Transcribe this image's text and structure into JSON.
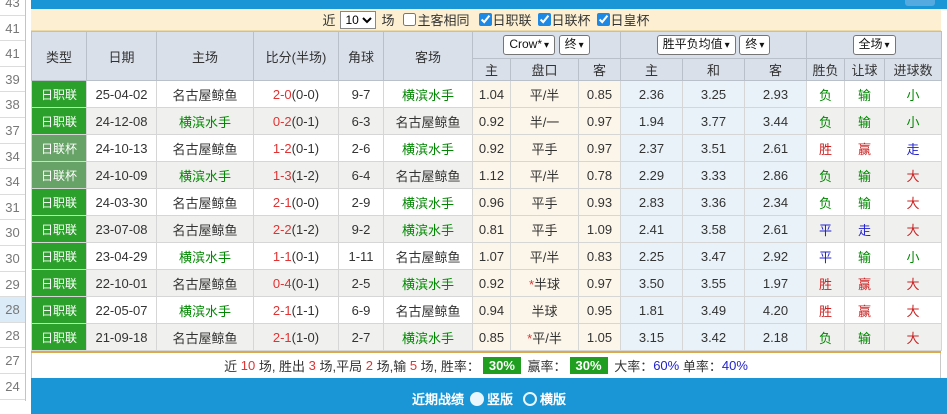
{
  "colors": {
    "bar_blue": "#1a96d6",
    "chip_blue": "#55abe0",
    "cream": "#fdf0d2",
    "header_bg": "#d9e0ea",
    "league_green": "#2ba12b",
    "cup_green": "#67a267",
    "team_green": "#008800",
    "score_red": "#e03333",
    "win_red": "#cc2222",
    "draw_blue": "#2222cc",
    "rate_badge_green": "#1f9e1f",
    "handicap_col_bg": "#fcf6ea",
    "avg_col_bg": "#e9f2f8",
    "row_alt_bg": "#f0f0ee"
  },
  "left_gutter": {
    "numbers": [
      "43",
      "41",
      "41",
      "39",
      "38",
      "37",
      "34",
      "34",
      "31",
      "30",
      "30",
      "29",
      "28",
      "28",
      "27",
      "24"
    ],
    "highlighted_index": 12
  },
  "filter_bar": {
    "recent_prefix": "近",
    "recent_value": "10",
    "recent_suffix": "场",
    "same_venue_label": "主客相同",
    "same_venue_checked": false,
    "leagues": [
      {
        "label": "日职联",
        "checked": true
      },
      {
        "label": "日联杯",
        "checked": true
      },
      {
        "label": "日皇杯",
        "checked": true
      }
    ]
  },
  "table": {
    "columns": [
      "类型",
      "日期",
      "主场",
      "比分(半场)",
      "角球",
      "客场"
    ],
    "group_selects": {
      "odds_source": "Crow*",
      "odds_time": "终",
      "avg_label": "胜平负均值",
      "avg_time": "终",
      "scope": "全场"
    },
    "sub_headers": [
      "主",
      "盘口",
      "客",
      "主",
      "和",
      "客",
      "胜负",
      "让球",
      "进球数"
    ],
    "rows": [
      {
        "league": "日职联",
        "cup": false,
        "date": "25-04-02",
        "home": "名古屋鲸鱼",
        "home_focus": false,
        "score": "2-0",
        "half": "(0-0)",
        "corners": "9-7",
        "away": "横滨水手",
        "away_focus": true,
        "odds": [
          "1.04",
          "平/半",
          "0.85"
        ],
        "star": false,
        "avg": [
          "2.36",
          "3.25",
          "2.93"
        ],
        "results": [
          {
            "t": "负",
            "c": "g"
          },
          {
            "t": "输",
            "c": "g"
          },
          {
            "t": "小",
            "c": "g"
          }
        ]
      },
      {
        "league": "日职联",
        "cup": false,
        "date": "24-12-08",
        "home": "横滨水手",
        "home_focus": true,
        "score": "0-2",
        "half": "(0-1)",
        "corners": "6-3",
        "away": "名古屋鲸鱼",
        "away_focus": false,
        "odds": [
          "0.92",
          "半/一",
          "0.97"
        ],
        "star": false,
        "avg": [
          "1.94",
          "3.77",
          "3.44"
        ],
        "results": [
          {
            "t": "负",
            "c": "g"
          },
          {
            "t": "输",
            "c": "g"
          },
          {
            "t": "小",
            "c": "g"
          }
        ]
      },
      {
        "league": "日联杯",
        "cup": true,
        "date": "24-10-13",
        "home": "名古屋鲸鱼",
        "home_focus": false,
        "score": "1-2",
        "half": "(0-1)",
        "corners": "2-6",
        "away": "横滨水手",
        "away_focus": true,
        "odds": [
          "0.92",
          "平手",
          "0.97"
        ],
        "star": false,
        "avg": [
          "2.37",
          "3.51",
          "2.61"
        ],
        "results": [
          {
            "t": "胜",
            "c": "r"
          },
          {
            "t": "赢",
            "c": "r"
          },
          {
            "t": "走",
            "c": "b"
          }
        ]
      },
      {
        "league": "日联杯",
        "cup": true,
        "date": "24-10-09",
        "home": "横滨水手",
        "home_focus": true,
        "score": "1-3",
        "half": "(1-2)",
        "corners": "6-4",
        "away": "名古屋鲸鱼",
        "away_focus": false,
        "odds": [
          "1.12",
          "平/半",
          "0.78"
        ],
        "star": false,
        "avg": [
          "2.29",
          "3.33",
          "2.86"
        ],
        "results": [
          {
            "t": "负",
            "c": "g"
          },
          {
            "t": "输",
            "c": "g"
          },
          {
            "t": "大",
            "c": "r"
          }
        ]
      },
      {
        "league": "日职联",
        "cup": false,
        "date": "24-03-30",
        "home": "名古屋鲸鱼",
        "home_focus": false,
        "score": "2-1",
        "half": "(0-0)",
        "corners": "2-9",
        "away": "横滨水手",
        "away_focus": true,
        "odds": [
          "0.96",
          "平手",
          "0.93"
        ],
        "star": false,
        "avg": [
          "2.83",
          "3.36",
          "2.34"
        ],
        "results": [
          {
            "t": "负",
            "c": "g"
          },
          {
            "t": "输",
            "c": "g"
          },
          {
            "t": "大",
            "c": "r"
          }
        ]
      },
      {
        "league": "日职联",
        "cup": false,
        "date": "23-07-08",
        "home": "名古屋鲸鱼",
        "home_focus": false,
        "score": "2-2",
        "half": "(1-2)",
        "corners": "9-2",
        "away": "横滨水手",
        "away_focus": true,
        "odds": [
          "0.81",
          "平手",
          "1.09"
        ],
        "star": false,
        "avg": [
          "2.41",
          "3.58",
          "2.61"
        ],
        "results": [
          {
            "t": "平",
            "c": "b"
          },
          {
            "t": "走",
            "c": "b"
          },
          {
            "t": "大",
            "c": "r"
          }
        ]
      },
      {
        "league": "日职联",
        "cup": false,
        "date": "23-04-29",
        "home": "横滨水手",
        "home_focus": true,
        "score": "1-1",
        "half": "(0-1)",
        "corners": "1-11",
        "away": "名古屋鲸鱼",
        "away_focus": false,
        "odds": [
          "1.07",
          "平/半",
          "0.83"
        ],
        "star": false,
        "avg": [
          "2.25",
          "3.47",
          "2.92"
        ],
        "results": [
          {
            "t": "平",
            "c": "b"
          },
          {
            "t": "输",
            "c": "g"
          },
          {
            "t": "小",
            "c": "g"
          }
        ]
      },
      {
        "league": "日职联",
        "cup": false,
        "date": "22-10-01",
        "home": "名古屋鲸鱼",
        "home_focus": false,
        "score": "0-4",
        "half": "(0-1)",
        "corners": "2-5",
        "away": "横滨水手",
        "away_focus": true,
        "odds": [
          "0.92",
          "半球",
          "0.97"
        ],
        "star": true,
        "avg": [
          "3.50",
          "3.55",
          "1.97"
        ],
        "results": [
          {
            "t": "胜",
            "c": "r"
          },
          {
            "t": "赢",
            "c": "r"
          },
          {
            "t": "大",
            "c": "r"
          }
        ]
      },
      {
        "league": "日职联",
        "cup": false,
        "date": "22-05-07",
        "home": "横滨水手",
        "home_focus": true,
        "score": "2-1",
        "half": "(1-1)",
        "corners": "6-9",
        "away": "名古屋鲸鱼",
        "away_focus": false,
        "odds": [
          "0.94",
          "半球",
          "0.95"
        ],
        "star": false,
        "avg": [
          "1.81",
          "3.49",
          "4.20"
        ],
        "results": [
          {
            "t": "胜",
            "c": "r"
          },
          {
            "t": "赢",
            "c": "r"
          },
          {
            "t": "大",
            "c": "r"
          }
        ]
      },
      {
        "league": "日职联",
        "cup": false,
        "date": "21-09-18",
        "home": "名古屋鲸鱼",
        "home_focus": false,
        "score": "2-1",
        "half": "(1-0)",
        "corners": "2-7",
        "away": "横滨水手",
        "away_focus": true,
        "odds": [
          "0.85",
          "平/半",
          "1.05"
        ],
        "star": true,
        "avg": [
          "3.15",
          "3.42",
          "2.18"
        ],
        "results": [
          {
            "t": "负",
            "c": "g"
          },
          {
            "t": "输",
            "c": "g"
          },
          {
            "t": "大",
            "c": "r"
          }
        ]
      }
    ]
  },
  "summary": {
    "segments": [
      {
        "t": "近 ",
        "c": "n"
      },
      {
        "t": "10",
        "c": "r"
      },
      {
        "t": " 场, 胜出 ",
        "c": "n"
      },
      {
        "t": "3",
        "c": "r"
      },
      {
        "t": " 场,平局 ",
        "c": "n"
      },
      {
        "t": "2",
        "c": "r"
      },
      {
        "t": " 场,输 ",
        "c": "n"
      },
      {
        "t": "5",
        "c": "r"
      },
      {
        "t": " 场, 胜率：",
        "c": "n"
      },
      {
        "t": "30%",
        "c": "badge"
      },
      {
        "t": " 赢率：",
        "c": "n"
      },
      {
        "t": "30%",
        "c": "badge"
      },
      {
        "t": " 大率：",
        "c": "n"
      },
      {
        "t": "60%",
        "c": "b"
      },
      {
        "t": " 单率：",
        "c": "n"
      },
      {
        "t": "40%",
        "c": "b"
      }
    ]
  },
  "bottom_bar": {
    "title": "近期战绩",
    "options": [
      {
        "label": "竖版",
        "selected": true
      },
      {
        "label": "横版",
        "selected": false
      }
    ]
  }
}
